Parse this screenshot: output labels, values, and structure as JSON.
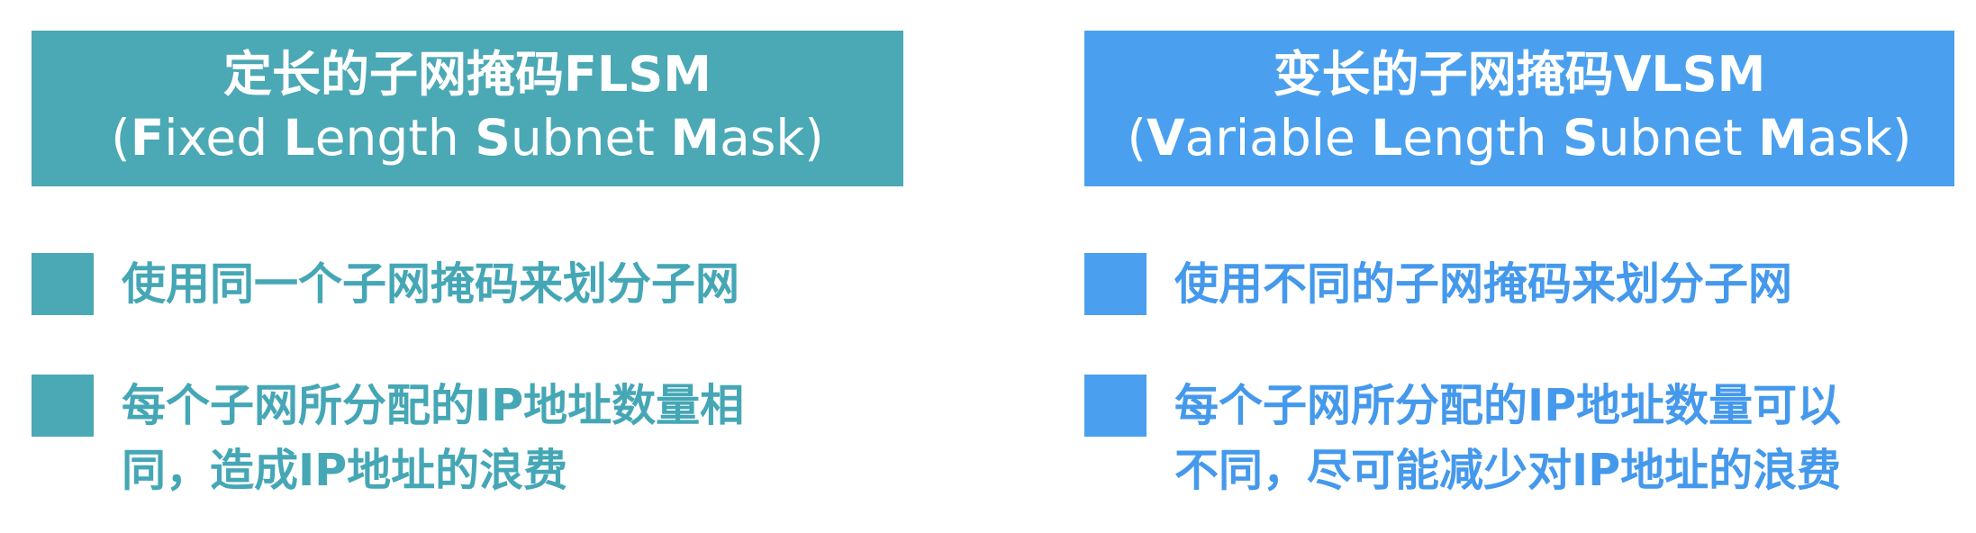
{
  "flsm": {
    "title": "定长的子网掩码FLSM",
    "subtitle": {
      "open": "(",
      "w1_initial": "F",
      "w1_rest": "ixed ",
      "w2_initial": "L",
      "w2_rest": "ength ",
      "w3_initial": "S",
      "w3_rest": "ubnet ",
      "w4_initial": "M",
      "w4_rest": "ask",
      "close": ")"
    },
    "points": [
      {
        "line1": "使用同一个子网掩码来划分子网",
        "line2": ""
      },
      {
        "line1": "每个子网所分配的IP地址数量相",
        "line2": "同，造成IP地址的浪费"
      }
    ]
  },
  "vlsm": {
    "title": "变长的子网掩码VLSM",
    "subtitle": {
      "open": "(",
      "w1_initial": "V",
      "w1_rest": "ariable ",
      "w2_initial": "L",
      "w2_rest": "ength ",
      "w3_initial": "S",
      "w3_rest": "ubnet ",
      "w4_initial": "M",
      "w4_rest": "ask",
      "close": ")"
    },
    "points": [
      {
        "line1": "使用不同的子网掩码来划分子网",
        "line2": ""
      },
      {
        "line1": "每个子网所分配的IP地址数量可以",
        "line2": "不同，尽可能减少对IP地址的浪费"
      }
    ]
  },
  "colors": {
    "flsm_accent": "#4ba8b5",
    "vlsm_accent": "#4aa0ee",
    "header_text": "#ffffff"
  }
}
